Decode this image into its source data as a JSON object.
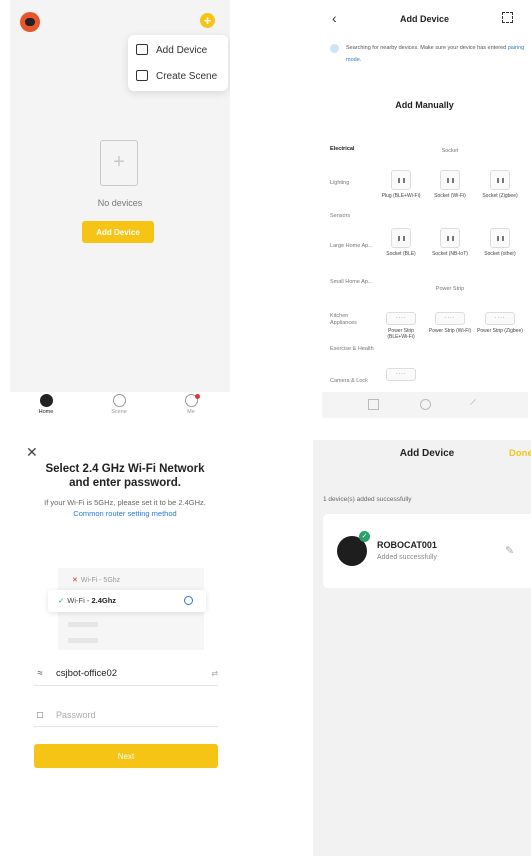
{
  "home": {
    "menu": [
      {
        "label": "Add Device",
        "icon": "add-device-icon"
      },
      {
        "label": "Create Scene",
        "icon": "create-scene-icon"
      }
    ],
    "empty_text": "No devices",
    "add_button": "Add Device",
    "tabs": [
      {
        "label": "Home",
        "icon": "paw-icon",
        "active": true
      },
      {
        "label": "Scene",
        "icon": "scene-icon",
        "active": false
      },
      {
        "label": "Me",
        "icon": "profile-icon",
        "active": false
      }
    ]
  },
  "add_device": {
    "title": "Add Device",
    "search_text": "Searching for nearby devices. Make sure your device has entered",
    "search_link": "pairing mode.",
    "manual_title": "Add Manually",
    "categories": [
      "Electrical",
      "Lighting",
      "Sensors",
      "Large Home Ap...",
      "Small Home Ap...",
      "Kitchen Appliances",
      "Exercise & Health",
      "Camera & Lock"
    ],
    "sections": [
      {
        "title": "Socket",
        "items": [
          "Plug (BLE+Wi-Fi)",
          "Socket (Wi-Fi)",
          "Socket (Zigbee)",
          "Socket (BLE)",
          "Socket (NB-IoT)",
          "Socket (other)"
        ]
      },
      {
        "title": "Power Strip",
        "items": [
          "Power Strip (BLE+Wi-Fi)",
          "Power Strip (Wi-Fi)",
          "Power Strip (Zigbee)"
        ]
      }
    ]
  },
  "wifi": {
    "title_line1": "Select 2.4 GHz Wi-Fi Network",
    "title_line2": "and enter password.",
    "hint": "If your Wi-Fi is 5GHz, please set it to be 2.4GHz.",
    "hint_link": "Common router setting method",
    "network_5g": "Wi-Fi - 5Ghz",
    "network_24_prefix": "Wi-Fi - ",
    "network_24_band": "2.4Ghz",
    "ssid": "csjbot-office02",
    "password_placeholder": "Password",
    "next_button": "Next"
  },
  "done": {
    "title": "Add Device",
    "done_label": "Done",
    "count_text": "1 device(s) added successfully",
    "device_name": "ROBOCAT001",
    "device_status": "Added successfully"
  },
  "colors": {
    "accent": "#f6c415",
    "link": "#2a79d7",
    "success": "#2aa36b",
    "error": "#e23333"
  }
}
